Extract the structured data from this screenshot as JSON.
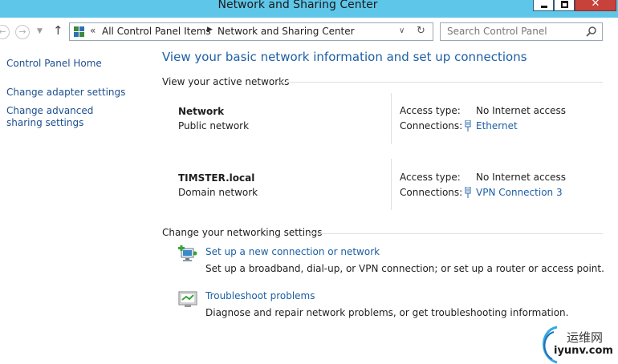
{
  "window": {
    "title": "Network and Sharing Center",
    "close_glyph": "✕"
  },
  "nav": {
    "back_glyph": "←",
    "forward_glyph": "→",
    "dropdown_glyph": "▼",
    "up_glyph": "↑",
    "address_chevron": "«",
    "breadcrumbs": [
      "All Control Panel Items",
      "Network and Sharing Center"
    ],
    "crumb_separator": "▶",
    "address_dropdown_glyph": "∨",
    "refresh_glyph": "↻",
    "search_placeholder": "Search Control Panel"
  },
  "sidebar": {
    "items": [
      {
        "label": "Control Panel Home"
      },
      {
        "label": "Change adapter settings"
      },
      {
        "label": "Change advanced sharing settings"
      }
    ]
  },
  "main": {
    "heading": "View your basic network information and set up connections",
    "active_networks_label": "View your active networks",
    "networks": [
      {
        "name": "Network",
        "type": "Public network",
        "access_label": "Access type:",
        "access_value": "No Internet access",
        "connections_label": "Connections:",
        "connection": "Ethernet"
      },
      {
        "name": "TIMSTER.local",
        "type": "Domain network",
        "access_label": "Access type:",
        "access_value": "No Internet access",
        "connections_label": "Connections:",
        "connection": "VPN Connection 3"
      }
    ],
    "settings_label": "Change your networking settings",
    "tasks": [
      {
        "link": "Set up a new connection or network",
        "desc": "Set up a broadband, dial-up, or VPN connection; or set up a router or access point.",
        "icon": "new-connection-icon"
      },
      {
        "link": "Troubleshoot problems",
        "desc": "Diagnose and repair network problems, or get troubleshooting information.",
        "icon": "troubleshoot-icon"
      }
    ]
  },
  "watermark": {
    "cn": "运维网",
    "en": "iyunv.com"
  },
  "colors": {
    "link": "#1d5fa5",
    "titlebar": "#5ec6e9",
    "close": "#c7423b"
  }
}
